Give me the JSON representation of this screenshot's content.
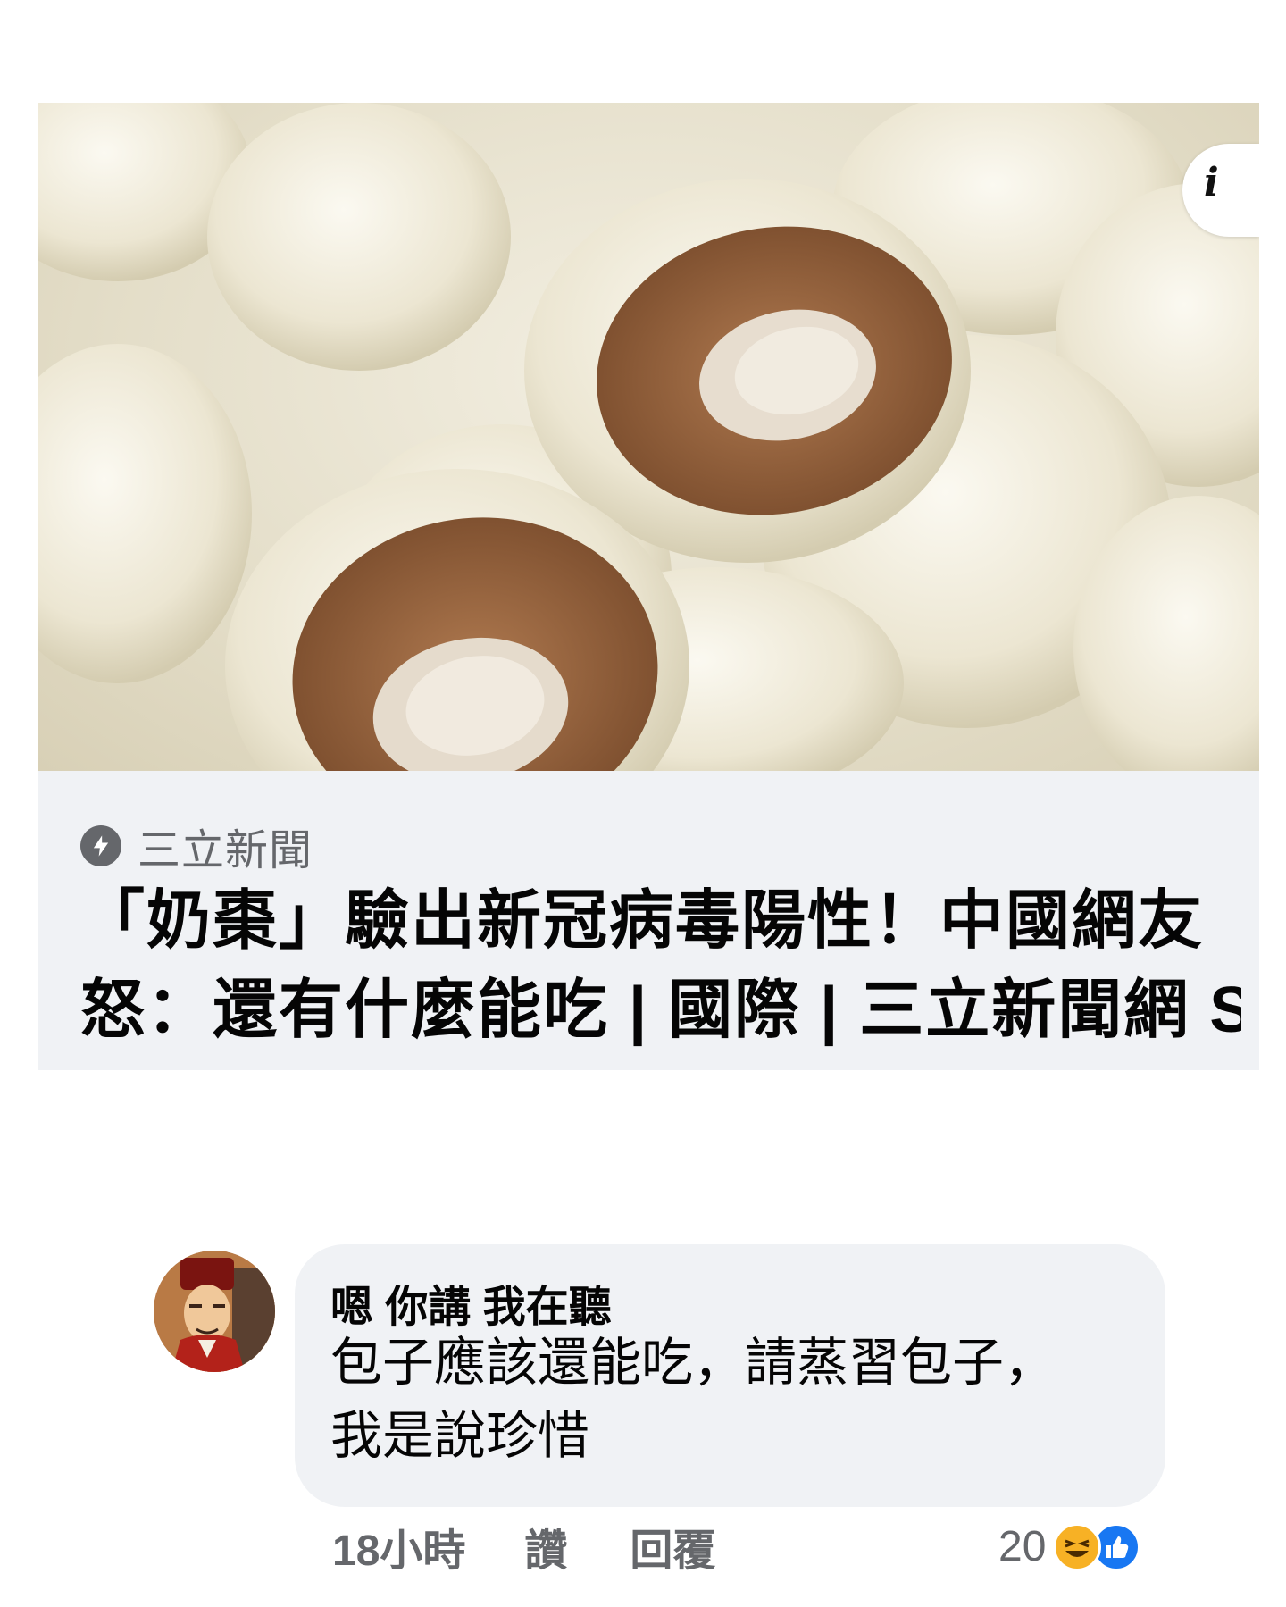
{
  "link_preview": {
    "image_alt": "奶棗",
    "info_icon": "info-icon",
    "source_icon": "bolt-icon",
    "source": "三立新聞",
    "headline_line1": "「奶棗」驗出新冠病毒陽性！中國網友",
    "headline_line2": "怒：還有什麼能吃 | 國際 | 三立新聞網 S..."
  },
  "comment": {
    "author": "嗯 你講 我在聽",
    "text_line1": "包子應該還能吃，請蒸習包子，",
    "text_line2": "我是說珍惜",
    "timestamp": "18小時",
    "like_label": "讚",
    "reply_label": "回覆",
    "reaction_count": "20",
    "reaction_icons": [
      "haha-icon",
      "like-icon"
    ]
  },
  "colors": {
    "bubble_bg": "#f0f2f5",
    "meta_text": "#65676b",
    "like_blue": "#1877f2",
    "haha_yellow": "#f7b125"
  }
}
